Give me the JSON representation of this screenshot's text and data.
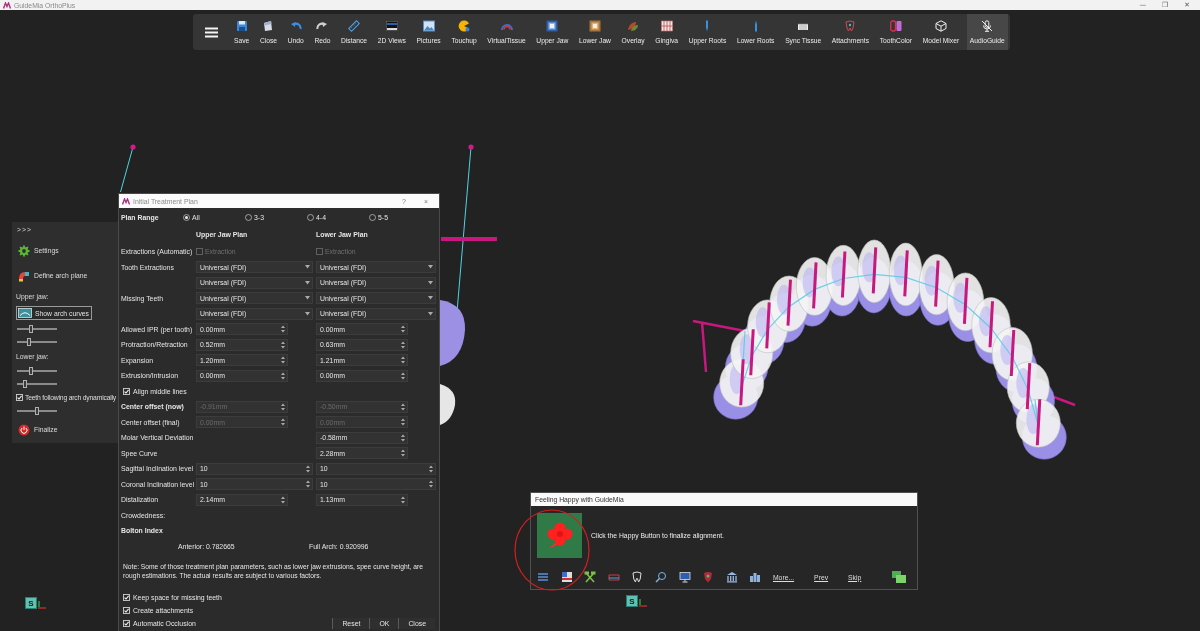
{
  "window": {
    "title": "GuideMia OrthoPlus",
    "controls": [
      "—",
      "❐",
      "✕"
    ]
  },
  "toolbar": {
    "items": [
      {
        "label": "Save",
        "selected": false
      },
      {
        "label": "Close",
        "selected": false
      },
      {
        "label": "Undo",
        "selected": false
      },
      {
        "label": "Redo",
        "selected": false
      },
      {
        "label": "Distance",
        "selected": false
      },
      {
        "label": "2D Views",
        "selected": false
      },
      {
        "label": "Pictures",
        "selected": false
      },
      {
        "label": "Touchup",
        "selected": false
      },
      {
        "label": "VirtualTissue",
        "selected": false
      },
      {
        "label": "Upper Jaw",
        "selected": false
      },
      {
        "label": "Lower Jaw",
        "selected": false
      },
      {
        "label": "Overlay",
        "selected": false
      },
      {
        "label": "Gingiva",
        "selected": false
      },
      {
        "label": "Upper Roots",
        "selected": false
      },
      {
        "label": "Lower Roots",
        "selected": false
      },
      {
        "label": "Sync Tissue",
        "selected": false
      },
      {
        "label": "Attachments",
        "selected": false
      },
      {
        "label": "ToothColor",
        "selected": false
      },
      {
        "label": "Model Mixer",
        "selected": false
      },
      {
        "label": "AudioGuide",
        "selected": true
      }
    ]
  },
  "side_panel": {
    "toggle": ">>>",
    "items": [
      {
        "kind": "action",
        "label": "Settings"
      },
      {
        "kind": "action",
        "label": "Define arch plane"
      },
      {
        "kind": "heading",
        "label": "Upper jaw:"
      },
      {
        "kind": "button",
        "label": "Show arch curves"
      },
      {
        "kind": "slider",
        "level": 0.35
      },
      {
        "kind": "slider",
        "level": 0.31
      },
      {
        "kind": "heading",
        "label": "Lower jaw:"
      },
      {
        "kind": "slider",
        "level": 0.35
      },
      {
        "kind": "slider",
        "level": 0.19
      },
      {
        "kind": "checkbox",
        "label": "Teeth following arch dynamically",
        "checked": true
      },
      {
        "kind": "slider",
        "level": 0.49
      },
      {
        "kind": "action",
        "label": "Finalize"
      }
    ]
  },
  "plan_dialog": {
    "title": "Initial Treatment Plan",
    "help": "?",
    "close": "×",
    "plan_range": {
      "label": "Plan Range",
      "options": [
        {
          "label": "All",
          "selected": true
        },
        {
          "label": "3-3",
          "selected": false
        },
        {
          "label": "4-4",
          "selected": false
        },
        {
          "label": "5-5",
          "selected": false
        }
      ]
    },
    "columns": [
      "Upper Jaw Plan",
      "Lower Jaw Plan"
    ],
    "rows": [
      {
        "kind": "checkbox",
        "label": "Extractions (Automatic)",
        "upper": {
          "text": "Extraction",
          "checked": false,
          "disabled": true
        },
        "lower": {
          "text": "Extraction",
          "checked": false,
          "disabled": true
        }
      },
      {
        "kind": "combo",
        "label": "Tooth Extractions",
        "upper": {
          "value": "Universal (FDI)"
        },
        "lower": {
          "value": "Universal (FDI)"
        }
      },
      {
        "kind": "combo",
        "upper": {
          "value": "Universal (FDI)"
        },
        "lower": {
          "value": "Universal (FDI)"
        }
      },
      {
        "kind": "combo",
        "label": "Missing Teeth",
        "upper": {
          "value": "Universal (FDI)"
        },
        "lower": {
          "value": "Universal (FDI)"
        }
      },
      {
        "kind": "combo",
        "upper": {
          "value": "Universal (FDI)"
        },
        "lower": {
          "value": "Universal (FDI)"
        }
      },
      {
        "kind": "spin",
        "label": "Allowed IPR (per tooth)",
        "upper": {
          "value": "0.00mm",
          "disabled": false
        },
        "lower": {
          "value": "0.00mm",
          "disabled": false
        }
      },
      {
        "kind": "spin",
        "label": "Protraction/Retraction",
        "upper": {
          "value": "0.52mm",
          "disabled": false
        },
        "lower": {
          "value": "0.63mm",
          "disabled": false
        }
      },
      {
        "kind": "spin",
        "label": "Expansion",
        "upper": {
          "value": "1.20mm",
          "disabled": false
        },
        "lower": {
          "value": "1.21mm",
          "disabled": false
        }
      },
      {
        "kind": "spin",
        "label": "Extrusion/Intrusion",
        "upper": {
          "value": "0.00mm",
          "disabled": false
        },
        "lower": {
          "value": "0.00mm",
          "disabled": false
        }
      },
      {
        "kind": "option",
        "label": "Align middle lines",
        "checked": true
      },
      {
        "kind": "spin",
        "label": "Center offset (now)",
        "bold": true,
        "upper": {
          "value": "-0.91mm",
          "disabled": true
        },
        "lower": {
          "value": "-0.50mm",
          "disabled": true
        }
      },
      {
        "kind": "spin",
        "label": "Center offset (final)",
        "upper": {
          "value": "0.00mm",
          "disabled": true
        },
        "lower": {
          "value": "0.00mm",
          "disabled": true
        }
      },
      {
        "kind": "spin",
        "label": "Molar Vertical Deviation",
        "lower": {
          "value": "-0.58mm",
          "disabled": false
        }
      },
      {
        "kind": "spin",
        "label": "Spee Curve",
        "lower": {
          "value": "2.28mm",
          "disabled": false
        }
      },
      {
        "kind": "wide_spin",
        "label": "Sagittal Inclination level",
        "upper": {
          "value": "10",
          "disabled": false
        },
        "lower": {
          "value": "10",
          "disabled": false
        }
      },
      {
        "kind": "wide_spin",
        "label": "Coronal Inclination level",
        "upper": {
          "value": "10",
          "disabled": false
        },
        "lower": {
          "value": "10",
          "disabled": false
        }
      },
      {
        "kind": "spin",
        "label": "Distalization",
        "upper": {
          "value": "2.14mm",
          "disabled": false
        },
        "lower": {
          "value": "1.13mm",
          "disabled": false
        }
      },
      {
        "kind": "label",
        "label": "Crowdedness:"
      },
      {
        "kind": "heading",
        "label": "Bolton Index"
      },
      {
        "kind": "values",
        "upper": "Anterior: 0.782665",
        "lower": "Full Arch: 0.920996"
      },
      {
        "kind": "note",
        "text": "Note: Some of those treatment plan parameters, such as lower jaw extrusions, spee curve height, are rough estimations. The actual results are subject to various factors."
      }
    ],
    "options": [
      {
        "label": "Keep space for missing teeth",
        "checked": true
      },
      {
        "label": "Create attachments",
        "checked": true
      },
      {
        "label": "Automatic Occlusion",
        "checked": true
      }
    ],
    "buttons": [
      "Reset",
      "OK",
      "Close"
    ]
  },
  "happy_popup": {
    "title": "Feeling Happy with GuideMia",
    "message": "Click the Happy Button to finalize alignment.",
    "links": [
      "More...",
      "Prev",
      "Skip"
    ]
  },
  "view_cubes": [
    {
      "label": "S"
    },
    {
      "label": "S"
    }
  ]
}
